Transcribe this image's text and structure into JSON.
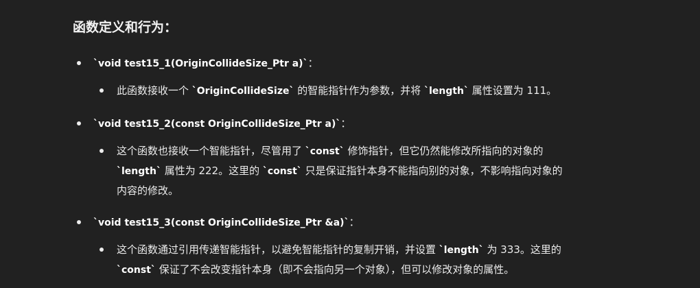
{
  "heading": "函数定义和行为：",
  "items": [
    {
      "signature": "`void test15_1(OriginCollideSize_Ptr a)`",
      "suffix": "：",
      "detail": {
        "p1": "此函数接收一个 ",
        "c1": "`OriginCollideSize`",
        "p2": " 的智能指针作为参数，并将 ",
        "c2": "`length`",
        "p3": " 属性设置为 111。"
      }
    },
    {
      "signature": "`void test15_2(const OriginCollideSize_Ptr a)`",
      "suffix": "：",
      "detail": {
        "p1": "这个函数也接收一个智能指针，尽管用了 ",
        "c1": "`const`",
        "p2": " 修饰指针，但它仍然能修改所指向的对象的",
        "c2": "`length`",
        "p3": " 属性为 222。这里的 ",
        "c3": "`const`",
        "p4": " 只是保证指针本身不能指向别的对象，不影响指向对象的内容的修改。"
      }
    },
    {
      "signature": "`void test15_3(const OriginCollideSize_Ptr &a)`",
      "suffix": "：",
      "detail": {
        "p1": "这个函数通过引用传递智能指针，以避免智能指针的复制开销，并设置 ",
        "c1": "`length`",
        "p2": " 为 333。这里的 ",
        "c2": "`const`",
        "p3": " 保证了不会改变指针本身（即不会指向另一个对象），但可以修改对象的属性。"
      }
    }
  ]
}
